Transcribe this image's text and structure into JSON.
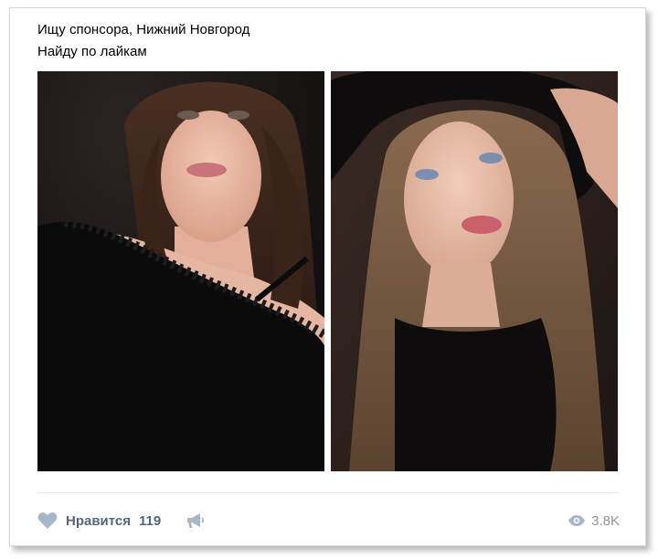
{
  "post": {
    "line1": "Ищу спонсора, Нижний Новгород",
    "line2": "Найду по лайкам"
  },
  "photos": [
    {
      "name": "left-photo",
      "description_icon": "portrait-photo-icon"
    },
    {
      "name": "right-photo",
      "description_icon": "portrait-photo-icon"
    }
  ],
  "actions": {
    "like_label": "Нравится",
    "like_count": "119",
    "views_count": "3.8K"
  },
  "icons": {
    "like": "heart-icon",
    "share": "megaphone-icon",
    "views": "eye-icon"
  },
  "colors": {
    "action_text": "#55677d",
    "icon": "#a8b7c8",
    "views_text": "#939393",
    "border": "#d3d9de"
  }
}
